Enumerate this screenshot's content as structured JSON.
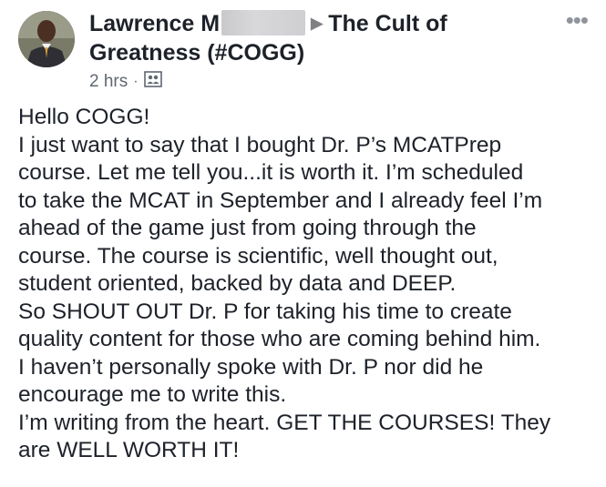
{
  "post": {
    "author": "Lawrence M",
    "arrow": "▶",
    "group": "The Cult of Greatness (#COGG)",
    "timestamp": "2 hrs",
    "separator": "·",
    "more": "•••",
    "icons": {
      "audience": "group-audience-icon",
      "more": "more-options-icon"
    },
    "lines": [
      "Hello COGG!",
      "I just want to say that I bought Dr. P’s MCATPrep",
      "course. Let me tell you...it is worth it. I’m scheduled",
      "to take the MCAT in September and I already feel I’m",
      "ahead of the game just from going through the",
      "course. The course is scientific, well thought out,",
      "student oriented, backed by data and DEEP.",
      "So SHOUT OUT Dr. P for taking his time to create",
      "quality content for those who are coming behind him.",
      "I haven’t personally spoke with Dr. P nor did he",
      "encourage me to write this.",
      "I’m writing from the heart. GET THE COURSES! They",
      "are WELL WORTH IT!"
    ]
  }
}
